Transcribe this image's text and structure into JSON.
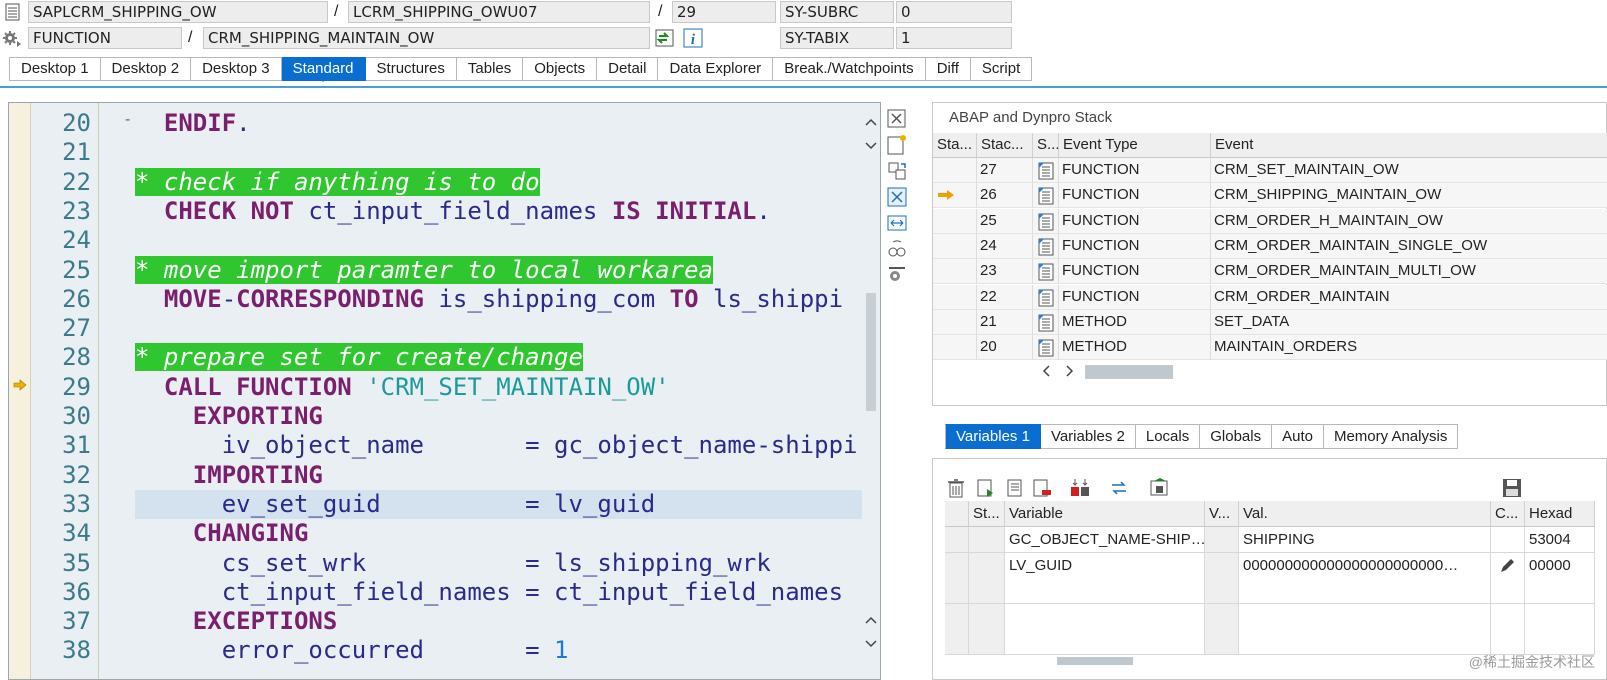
{
  "header": {
    "program": "SAPLCRM_SHIPPING_OW",
    "include": "LCRM_SHIPPING_OWU07",
    "line": "29",
    "sys_field_1": "SY-SUBRC",
    "sys_value_1": "0",
    "event_type": "FUNCTION",
    "event_name": "CRM_SHIPPING_MAINTAIN_OW",
    "sys_field_2": "SY-TABIX",
    "sys_value_2": "1",
    "slash": "/"
  },
  "tabs": [
    "Desktop 1",
    "Desktop 2",
    "Desktop 3",
    "Standard",
    "Structures",
    "Tables",
    "Objects",
    "Detail",
    "Data Explorer",
    "Break./Watchpoints",
    "Diff",
    "Script"
  ],
  "code_lines": [
    {
      "n": "20",
      "parts": [
        {
          "c": "kw",
          "t": "  ENDIF"
        },
        {
          "c": "id",
          "t": "."
        }
      ]
    },
    {
      "n": "21",
      "parts": []
    },
    {
      "n": "22",
      "parts": [
        {
          "c": "cmt",
          "t": "* check if anything is to do"
        }
      ]
    },
    {
      "n": "23",
      "parts": [
        {
          "c": "kw",
          "t": "  CHECK NOT "
        },
        {
          "c": "id",
          "t": "ct_input_field_names "
        },
        {
          "c": "kw",
          "t": "IS INITIAL"
        },
        {
          "c": "id",
          "t": "."
        }
      ]
    },
    {
      "n": "24",
      "parts": []
    },
    {
      "n": "25",
      "parts": [
        {
          "c": "cmt",
          "t": "* move import paramter to local workarea"
        }
      ]
    },
    {
      "n": "26",
      "parts": [
        {
          "c": "kw",
          "t": "  MOVE"
        },
        {
          "c": "id",
          "t": "-"
        },
        {
          "c": "kw",
          "t": "CORRESPONDING "
        },
        {
          "c": "id",
          "t": "is_shipping_com "
        },
        {
          "c": "kw",
          "t": "TO "
        },
        {
          "c": "id",
          "t": "ls_shippi"
        }
      ]
    },
    {
      "n": "27",
      "parts": []
    },
    {
      "n": "28",
      "parts": [
        {
          "c": "cmt",
          "t": "* prepare set for create/change"
        }
      ]
    },
    {
      "n": "29",
      "parts": [
        {
          "c": "kw",
          "t": "  CALL FUNCTION "
        },
        {
          "c": "str",
          "t": "'CRM_SET_MAINTAIN_OW'"
        }
      ]
    },
    {
      "n": "30",
      "parts": [
        {
          "c": "kw",
          "t": "    EXPORTING"
        }
      ]
    },
    {
      "n": "31",
      "parts": [
        {
          "c": "id",
          "t": "      iv_object_name       = gc_object_name-shippi"
        }
      ]
    },
    {
      "n": "32",
      "parts": [
        {
          "c": "kw",
          "t": "    IMPORTING"
        }
      ]
    },
    {
      "n": "33",
      "parts": [
        {
          "c": "id",
          "t": "      ev_set_guid          = lv_guid"
        }
      ]
    },
    {
      "n": "34",
      "parts": [
        {
          "c": "kw",
          "t": "    CHANGING"
        }
      ]
    },
    {
      "n": "35",
      "parts": [
        {
          "c": "id",
          "t": "      cs_set_wrk           = ls_shipping_wrk"
        }
      ]
    },
    {
      "n": "36",
      "parts": [
        {
          "c": "id",
          "t": "      ct_input_field_names = ct_input_field_names"
        }
      ]
    },
    {
      "n": "37",
      "parts": [
        {
          "c": "kw",
          "t": "    EXCEPTIONS"
        }
      ]
    },
    {
      "n": "38",
      "parts": [
        {
          "c": "id",
          "t": "      error_occurred       = "
        },
        {
          "c": "num",
          "t": "1"
        }
      ]
    }
  ],
  "stack": {
    "title": "ABAP and Dynpro Stack",
    "columns": [
      "Sta...",
      "Stac...",
      "S...",
      "Event Type",
      "Event"
    ],
    "rows": [
      {
        "level": "27",
        "type": "FUNCTION",
        "event": "CRM_SET_MAINTAIN_OW",
        "current": false
      },
      {
        "level": "26",
        "type": "FUNCTION",
        "event": "CRM_SHIPPING_MAINTAIN_OW",
        "current": true
      },
      {
        "level": "25",
        "type": "FUNCTION",
        "event": "CRM_ORDER_H_MAINTAIN_OW",
        "current": false
      },
      {
        "level": "24",
        "type": "FUNCTION",
        "event": "CRM_ORDER_MAINTAIN_SINGLE_OW",
        "current": false
      },
      {
        "level": "23",
        "type": "FUNCTION",
        "event": "CRM_ORDER_MAINTAIN_MULTI_OW",
        "current": false
      },
      {
        "level": "22",
        "type": "FUNCTION",
        "event": "CRM_ORDER_MAINTAIN",
        "current": false
      },
      {
        "level": "21",
        "type": "METHOD",
        "event": "SET_DATA",
        "current": false
      },
      {
        "level": "20",
        "type": "METHOD",
        "event": "MAINTAIN_ORDERS",
        "current": false
      }
    ]
  },
  "var_tabs": [
    "Variables 1",
    "Variables 2",
    "Locals",
    "Globals",
    "Auto",
    "Memory Analysis"
  ],
  "variables": {
    "columns": [
      "St...",
      "Variable",
      "V...",
      "Val.",
      "C...",
      "Hexad"
    ],
    "rows": [
      {
        "name": "GC_OBJECT_NAME-SHIP…",
        "value": "SHIPPING",
        "hex": "53004"
      },
      {
        "name": "LV_GUID",
        "value": "000000000000000000000000…",
        "hex": "00000"
      }
    ]
  },
  "watermark": "@稀土掘金技术社区"
}
